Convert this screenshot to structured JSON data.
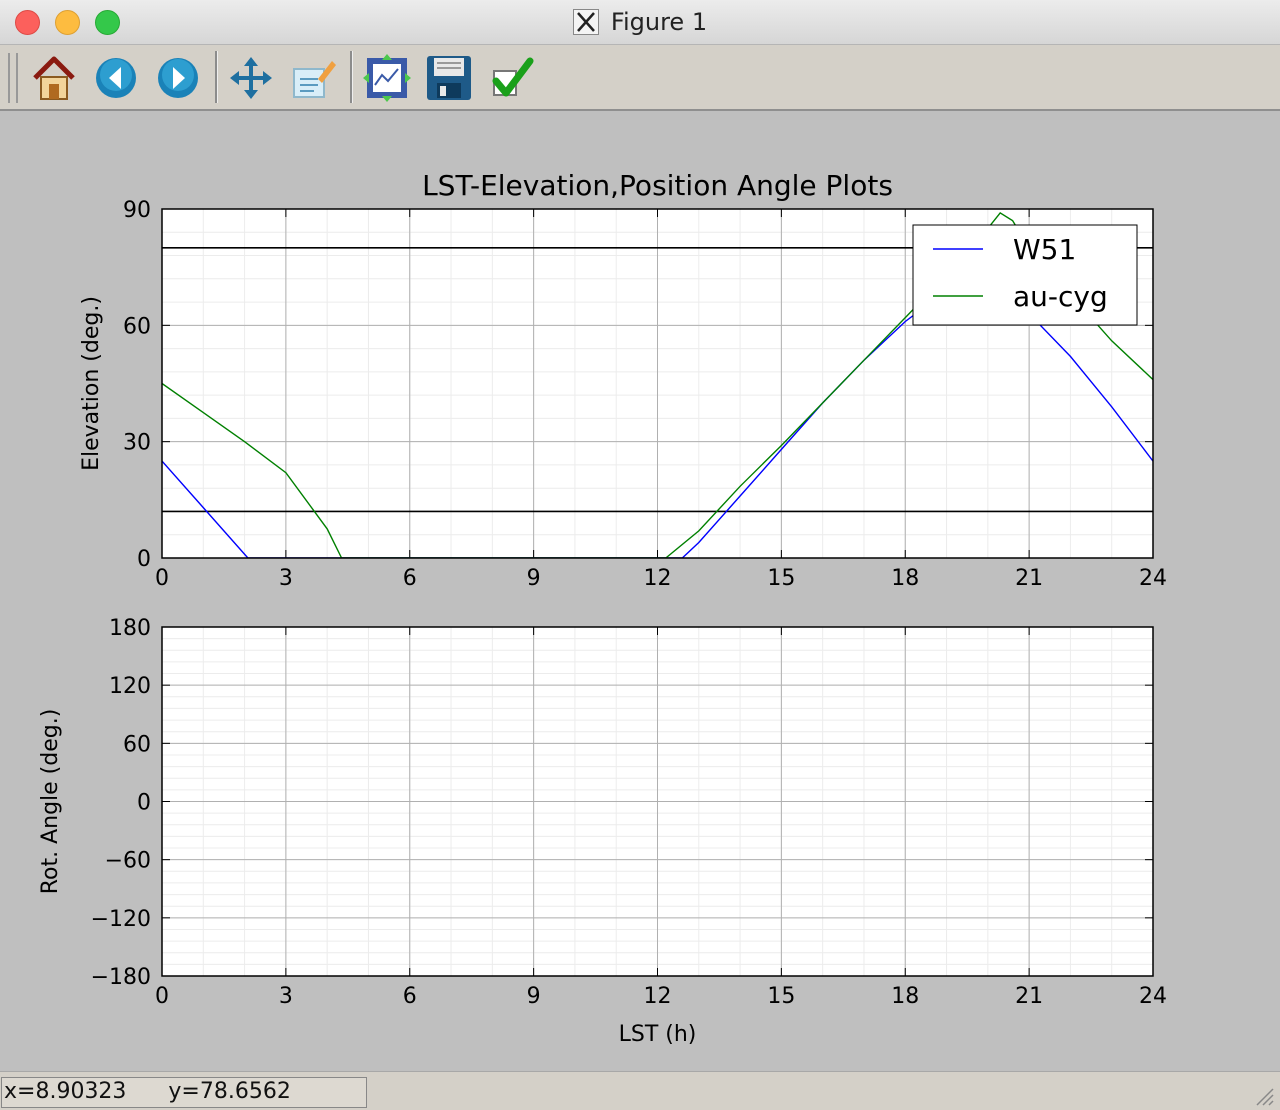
{
  "window": {
    "title": "Figure 1"
  },
  "toolbar": {
    "buttons": [
      {
        "name": "home-icon"
      },
      {
        "name": "back-icon"
      },
      {
        "name": "forward-icon"
      },
      {
        "name": "pan-icon"
      },
      {
        "name": "zoom-icon"
      },
      {
        "name": "subplots-icon"
      },
      {
        "name": "save-icon"
      },
      {
        "name": "customize-icon"
      }
    ]
  },
  "status": {
    "x_text": "x=8.90323",
    "y_text": "y=78.6562"
  },
  "colors": {
    "w51": "#0000ff",
    "aucyg": "#008000",
    "figure_bg": "#bfbfbf"
  },
  "chart_data": [
    {
      "type": "line",
      "title": "LST-Elevation,Position Angle Plots",
      "xlabel": "",
      "ylabel": "Elevation (deg.)",
      "xlim": [
        0,
        24
      ],
      "ylim": [
        0,
        90
      ],
      "xticks": [
        "0",
        "3",
        "6",
        "9",
        "12",
        "15",
        "18",
        "21",
        "24"
      ],
      "yticks": [
        "0",
        "30",
        "60",
        "90"
      ],
      "grid": true,
      "legend": {
        "placement": "top-right",
        "entries": [
          "W51",
          "au-cyg"
        ]
      },
      "hlines": [
        80,
        12
      ],
      "series": [
        {
          "name": "W51",
          "color": "#0000ff",
          "x": [
            0,
            1,
            2.08,
            12.6,
            13,
            14,
            15,
            16,
            17,
            18,
            18.5,
            19,
            19.5,
            20,
            20.5,
            21,
            22,
            23,
            24
          ],
          "y": [
            25,
            13,
            0,
            0,
            4,
            16,
            28,
            40,
            51,
            61,
            65,
            68,
            69,
            68,
            66,
            63,
            52,
            39,
            25
          ]
        },
        {
          "name": "au-cyg",
          "color": "#008000",
          "x": [
            0,
            1,
            2,
            3,
            4,
            4.35,
            12.2,
            13,
            14,
            15,
            16,
            17,
            18,
            19,
            20,
            20.3,
            20.6,
            21,
            22,
            23,
            24
          ],
          "y": [
            45,
            37.5,
            30,
            22,
            7.5,
            0,
            0,
            7,
            18.5,
            29,
            40,
            51,
            62,
            73,
            85,
            89,
            87,
            80,
            68,
            56,
            46
          ]
        }
      ]
    },
    {
      "type": "line",
      "title": "",
      "xlabel": "LST (h)",
      "ylabel": "Rot. Angle (deg.)",
      "xlim": [
        0,
        24
      ],
      "ylim": [
        -180,
        180
      ],
      "xticks": [
        "0",
        "3",
        "6",
        "9",
        "12",
        "15",
        "18",
        "21",
        "24"
      ],
      "yticks": [
        "−180",
        "−120",
        "−60",
        "0",
        "60",
        "120",
        "180"
      ],
      "grid": true,
      "series": []
    }
  ]
}
